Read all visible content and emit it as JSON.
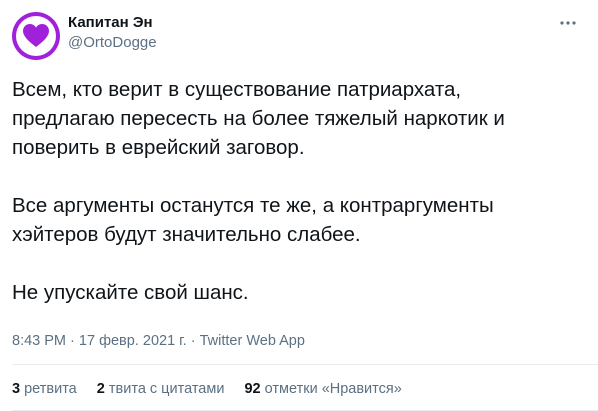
{
  "author": {
    "display_name": "Капитан Эн",
    "handle": "@OrtoDogge",
    "avatar_icon": "heart-icon",
    "avatar_color": "#a021d9"
  },
  "tweet": {
    "paragraphs": [
      "Всем, кто верит в существование патриархата,\nпредлагаю пересесть на более тяжелый наркотик и\nповерить в еврейский заговор.",
      "Все аргументы останутся те же, а контраргументы\nхэйтеров будут значительно слабее.",
      "Не упускайте свой шанс."
    ]
  },
  "meta": {
    "time": "8:43 PM",
    "date": "17 февр. 2021 г.",
    "separator": "·",
    "app": "Twitter Web App"
  },
  "stats": {
    "retweets": {
      "count": "3",
      "label": "ретвита"
    },
    "quotes": {
      "count": "2",
      "label": "твита с цитатами"
    },
    "likes": {
      "count": "92",
      "label": "отметки «Нравится»"
    }
  },
  "icons": {
    "more": "more-dots-icon"
  },
  "colors": {
    "text": "#0f1419",
    "secondary": "#5b7083",
    "divider": "#e6ecf0"
  }
}
